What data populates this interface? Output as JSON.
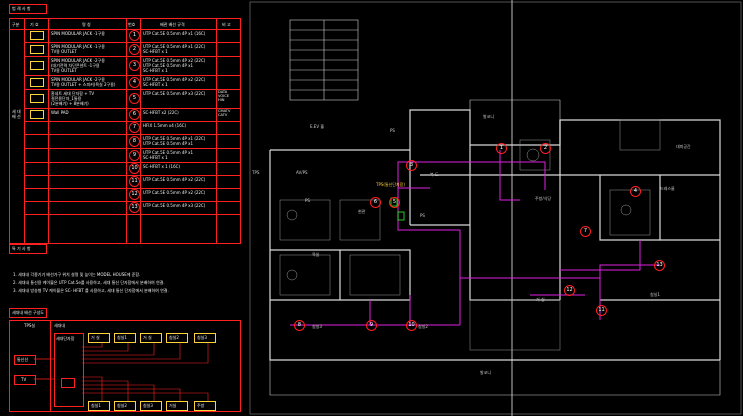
{
  "legend": {
    "title": "범 례 사 항",
    "headers": {
      "division": "구분",
      "symbol": "기 호",
      "name": "명    칭",
      "number": "번호",
      "cable": "배관 배선 규격",
      "note": "비 고"
    },
    "group_label": "세 대\n배 선",
    "rows": [
      {
        "name": [
          "SPIN MODULAR JACK -1구용"
        ],
        "number": "1",
        "cable": [
          "UTP Cat.5E 0.5mm 4P x1 (16C)"
        ],
        "note": "",
        "icon": "modular-jack-icon"
      },
      {
        "name": [
          "SPIN MODULAR JACK -1구용",
          "TV용 OUTLET"
        ],
        "number": "2",
        "cable": [
          "UTP Cat.5E 0.5mm 4P x1 (22C)",
          "SC-HFBT x 1"
        ],
        "note": "",
        "icon": "jack-tv-outlet-icon"
      },
      {
        "name": [
          "SPIN MODULAR JACK -2구용",
          "(대기전력 차단콘센트 -1구용",
          "TV용 OUTLET"
        ],
        "number": "3",
        "cable": [
          "UTP Cat.5E 0.5mm 4P x2 (22C)",
          "UTP Cat.5E 0.5mm 4P x1",
          "SC-HFBT x 1"
        ],
        "note": "",
        "icon": "jack-2port-icon"
      },
      {
        "name": [
          "SPIN MODULAR JACK -2구용",
          "TV용 OUTLET + 스피커(욕실 2구용)"
        ],
        "number": "4",
        "cable": [
          "UTP Cat.5E 0.5mm 4P x2 (22C)",
          "SC-HFBT x 1"
        ],
        "note": "",
        "icon": "jack-speaker-icon"
      },
      {
        "name": [
          "홈네트 세대 단자함 + TV",
          "절전용단자_1통용",
          "(2분배기) + 8분배기)"
        ],
        "number": "5",
        "cable": [
          "UTP Cat.5E 0.5mm 4P x3 (22C)"
        ],
        "note": "DATA\nVOICE\nHIN",
        "icon": "home-terminal-icon"
      },
      {
        "name": [
          "Wall PAD"
        ],
        "number": "6",
        "cable": [
          "SC-HFBT x2 (22C)"
        ],
        "note": "CMATV\nCATV",
        "icon": "wall-pad-icon"
      },
      {
        "name": [],
        "number": "7",
        "cable": [
          "HFIX 1.5mm x4 (16C)"
        ],
        "note": "",
        "icon": ""
      },
      {
        "name": [],
        "number": "8",
        "cable": [
          "UTP Cat.5E 0.5mm 4P x1 (22C)",
          "UTP Cat.5E 0.5mm 4P x1"
        ],
        "note": "",
        "icon": ""
      },
      {
        "name": [],
        "number": "9",
        "cable": [
          "UTP Cat.5E 0.5mm 4P x1",
          "SC-HFBT x 1"
        ],
        "note": "",
        "icon": ""
      },
      {
        "name": [],
        "number": "10",
        "cable": [
          "SC-HFBT x 1 (16C)"
        ],
        "note": "",
        "icon": ""
      },
      {
        "name": [],
        "number": "11",
        "cable": [
          "UTP Cat.5E 0.5mm 4P x2 (22C)"
        ],
        "note": "",
        "icon": ""
      },
      {
        "name": [],
        "number": "12",
        "cable": [
          "UTP Cat.5E 0.5mm 4P x2 (22C)"
        ],
        "note": "",
        "icon": ""
      },
      {
        "name": [],
        "number": "13",
        "cable": [
          "UTP Cat.5E 0.5mm 4P x3 (22C)"
        ],
        "note": "",
        "icon": ""
      }
    ],
    "notes_title": "특 기 사 항",
    "notes": [
      "1. 세대내 각종기기 배선가구 위치 설명 및 높이는 MODEL HOUSE에 준함.",
      "2. 세대내 통신용 케이블은 UTP Cat.5e를 사용하고, 세대 통신 단자함에서 분배하여 연결.",
      "3. 세대내 방송형 TV 케이블은 SC- HFBT 를 사용하고, 세대 통신 단자함에서 분배하여 연결."
    ]
  },
  "riser": {
    "title": "세대내 배선 구성도",
    "tps_label": "TPS실",
    "unit_label": "세대내",
    "panel_label": "세대단자함",
    "left_labels": [
      "통신선",
      "TV"
    ],
    "room_labels_top": [
      "거 실",
      "침실1",
      "거 실",
      "침실2",
      "침실3"
    ],
    "room_labels_bottom": [
      "침실1",
      "침실2",
      "침실3",
      "거실",
      "주방"
    ]
  },
  "plan": {
    "labels": [
      {
        "text": "E.EV 홀",
        "id": "elev-hall"
      },
      {
        "text": "발코니",
        "id": "balcony-top"
      },
      {
        "text": "TPS",
        "id": "tps"
      },
      {
        "text": "AV/PS",
        "id": "avps"
      },
      {
        "text": "PS",
        "id": "ps-1"
      },
      {
        "text": "PS",
        "id": "ps-2"
      },
      {
        "text": "PS",
        "id": "ps-3"
      },
      {
        "text": "현관",
        "id": "entrance"
      },
      {
        "text": "TPS(통신단자함)",
        "id": "tps-panel"
      },
      {
        "text": "주방/식당",
        "id": "kitchen"
      },
      {
        "text": "드레스룸",
        "id": "dressroom"
      },
      {
        "text": "대피공간",
        "id": "refuge"
      },
      {
        "text": "침실3",
        "id": "bedroom3"
      },
      {
        "text": "침실2",
        "id": "bedroom2"
      },
      {
        "text": "욕실",
        "id": "bath"
      },
      {
        "text": "거 실",
        "id": "living"
      },
      {
        "text": "침실1",
        "id": "bedroom1"
      },
      {
        "text": "발코니",
        "id": "balcony-bottom"
      },
      {
        "text": "복 도",
        "id": "corridor"
      }
    ],
    "markers": [
      "1",
      "2",
      "3",
      "4",
      "5",
      "6",
      "7",
      "8",
      "9",
      "10",
      "11",
      "12",
      "13"
    ]
  },
  "colors": {
    "frame": "#ff2020",
    "wire": "#e020e0",
    "accent": "#ffd23a",
    "wall": "#d8d8d8",
    "green": "#2aff2a"
  }
}
